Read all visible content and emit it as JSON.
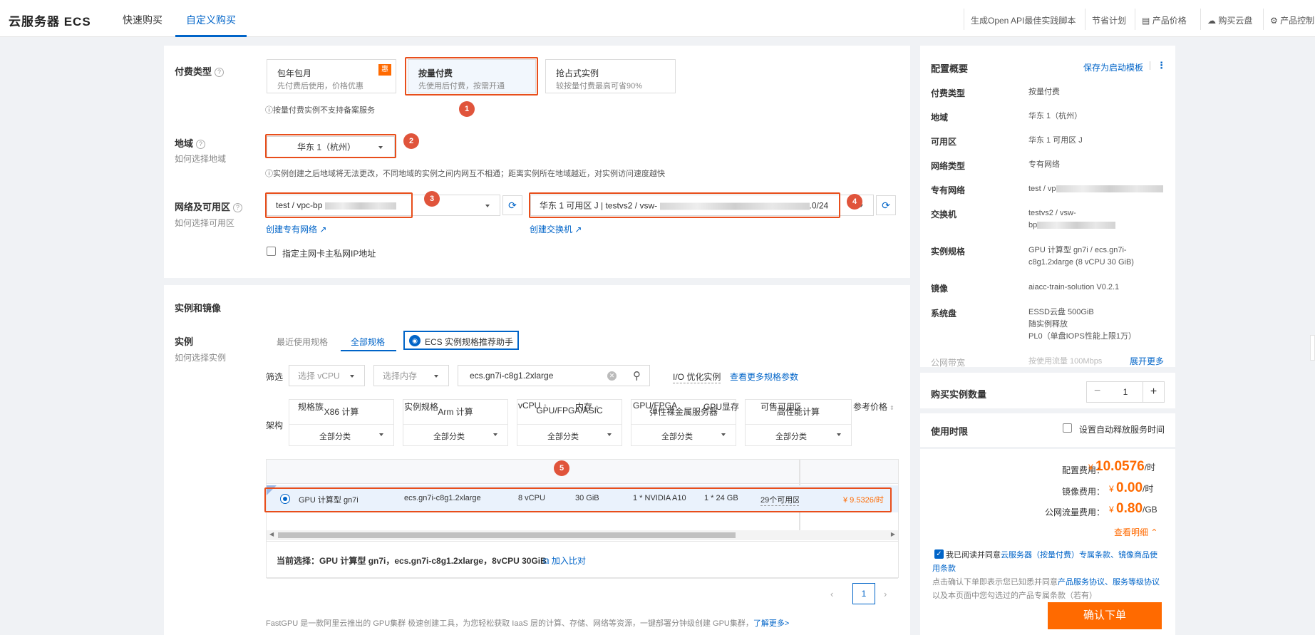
{
  "header": {
    "brand": "云服务器 ECS",
    "tabs": [
      "快速购买",
      "自定义购买"
    ],
    "links": [
      "生成Open API最佳实践脚本",
      "节省计划",
      "产品价格",
      "购买云盘",
      "产品控制"
    ]
  },
  "billing": {
    "label": "付费类型",
    "options": [
      {
        "title": "包年包月",
        "desc": "先付费后使用，价格优惠",
        "tag": "惠"
      },
      {
        "title": "按量付费",
        "desc": "先使用后付费，按需开通"
      },
      {
        "title": "抢占式实例",
        "desc": "较按量付费最高可省90%"
      }
    ],
    "note": "ⓘ按量付费实例不支持备案服务"
  },
  "region": {
    "label": "地域",
    "help": "如何选择地域",
    "value": "华东 1（杭州）",
    "note": "ⓘ实例创建之后地域将无法更改，不同地域的实例之间内网互不相通；距离实例所在地域越近，对实例访问速度越快"
  },
  "network": {
    "label": "网络及可用区",
    "help": "如何选择可用区",
    "vpc_prefix": "test / vpc-bp",
    "vswitch_prefix": "华东 1 可用区 J | testvs2 / vsw-",
    "vswitch_suffix": ".0/24",
    "create_vpc": "创建专有网络",
    "create_vsw": "创建交换机",
    "private_ip": "指定主网卡主私网IP地址"
  },
  "instance": {
    "section": "实例和镜像",
    "label": "实例",
    "help": "如何选择实例",
    "tabs": [
      "最近使用规格",
      "全部规格"
    ],
    "assistant": "ECS 实例规格推荐助手",
    "filter_label": "筛选",
    "vcpu_placeholder": "选择 vCPU",
    "mem_placeholder": "选择内存",
    "search_value": "ecs.gn7i-c8g1.2xlarge",
    "io_opt": "I/O 优化实例",
    "more_params": "查看更多规格参数",
    "arch_label": "架构",
    "arch": [
      "X86 计算",
      "Arm 计算",
      "GPU/FPGA/ASIC",
      "弹性裸金属服务器",
      "高性能计算"
    ],
    "arch_sub": "全部分类",
    "columns": [
      "规格族",
      "实例规格",
      "vCPU",
      "内存",
      "GPU/FPGA",
      "GPU显存",
      "可售可用区",
      "参考价格"
    ],
    "row": {
      "family": "GPU 计算型 gn7i",
      "spec": "ecs.gn7i-c8g1.2xlarge",
      "vcpu": "8 vCPU",
      "mem": "30 GiB",
      "gpu": "1 * NVIDIA A10",
      "gpumem": "1 * 24 GB",
      "zones": "29个可用区",
      "price": "¥ 9.5326/时"
    },
    "current_label": "当前选择：",
    "current": "GPU 计算型 gn7i，ecs.gn7i-c8g1.2xlarge，8vCPU 30GiB",
    "compare": "加入比对",
    "page": "1",
    "footer": "FastGPU 是一款阿里云推出的 GPU集群 极速创建工具，为您轻松获取 IaaS 层的计算、存储、网络等资源，一键部署分钟级创建 GPU集群，",
    "footer_link": "了解更多>"
  },
  "summary": {
    "title": "配置概要",
    "save_template": "保存为启动模板",
    "rows": [
      {
        "k": "付费类型",
        "v": [
          "按量付费"
        ]
      },
      {
        "k": "地域",
        "v": [
          "华东 1（杭州）"
        ]
      },
      {
        "k": "可用区",
        "v": [
          "华东 1 可用区 J"
        ]
      },
      {
        "k": "网络类型",
        "v": [
          "专有网络"
        ]
      },
      {
        "k": "专有网络",
        "v": [
          "test / vp"
        ]
      },
      {
        "k": "交换机",
        "v": [
          "testvs2 / vsw-",
          "bp"
        ]
      },
      {
        "k": "实例规格",
        "v": [
          "GPU 计算型 gn7i / ecs.gn7i-",
          "c8g1.2xlarge (8 vCPU 30 GiB)"
        ]
      },
      {
        "k": "镜像",
        "v": [
          "aiacc-train-solution V0.2.1"
        ]
      },
      {
        "k": "系统盘",
        "v": [
          "ESSD云盘 500GiB",
          "随实例释放",
          "PL0（单盘IOPS性能上限1万）"
        ]
      },
      {
        "k": "公网带宽",
        "v": [
          "按使用流量 100Mbps"
        ]
      }
    ],
    "expand": "展开更多",
    "qty_label": "购买实例数量",
    "qty": "1",
    "period_label": "使用时限",
    "auto_release": "设置自动释放服务时间",
    "config_fee_label": "配置费用：",
    "config_fee": "10.0576",
    "config_unit": "/时",
    "image_fee_label": "镜像费用：",
    "image_fee": "0.00",
    "image_unit": "/时",
    "net_fee_label": "公网流量费用：",
    "net_fee": "0.80",
    "net_unit": "/GB",
    "currency": "¥",
    "detail": "查看明细",
    "agree_1": "我已阅读并同意",
    "agree_link": "云服务器（按量付费）专属条款、镜像商品使用条款",
    "agree_2": "点击确认下单即表示您已知悉并同意",
    "agree_link2": "产品服务协议、服务等级协议",
    "agree_3": "以及本页面中您勾选过的产品专属条款（若有）",
    "confirm": "确认下单"
  },
  "annotations": [
    "1",
    "2",
    "3",
    "4",
    "5"
  ]
}
